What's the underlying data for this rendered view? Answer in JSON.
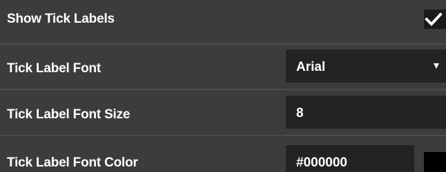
{
  "rows": {
    "show_tick_labels": {
      "label": "Show Tick Labels",
      "checked": true
    },
    "tick_label_font": {
      "label": "Tick Label Font",
      "value": "Arial",
      "icon": "caret-down-icon"
    },
    "tick_label_font_size": {
      "label": "Tick Label Font Size",
      "value": "8"
    },
    "tick_label_font_color": {
      "label": "Tick Label Font Color",
      "value": "#000000",
      "swatch_color": "#000000"
    }
  },
  "colors": {
    "panel_background": "#3c3c3c",
    "field_background": "#232323",
    "divider": "#4d4d4d",
    "text": "#ffffff"
  }
}
